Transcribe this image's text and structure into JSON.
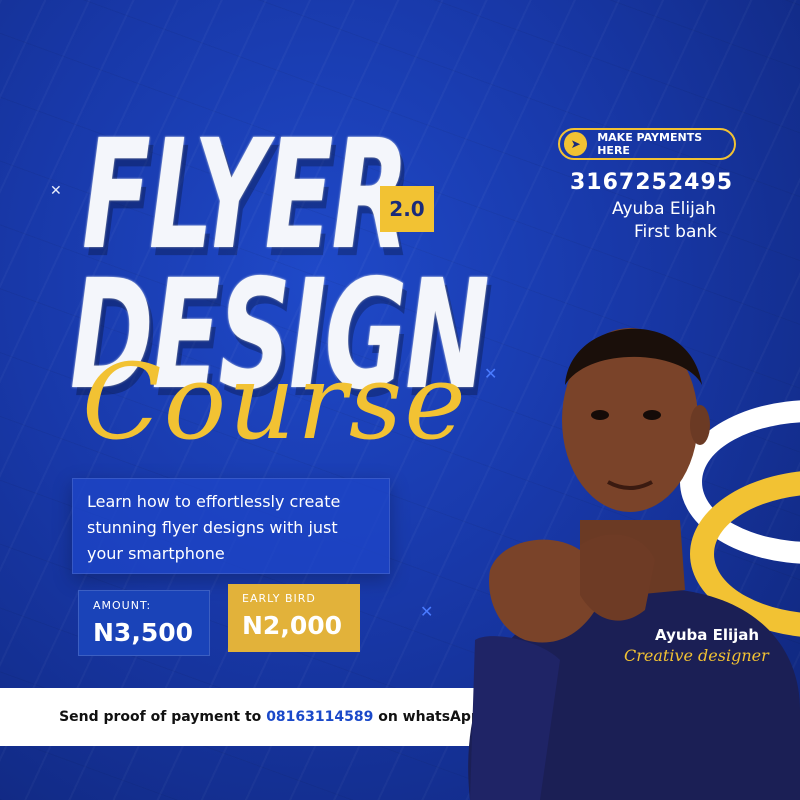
{
  "title": {
    "line1": "FLYER",
    "line2": "DESIGN",
    "script": "Course",
    "version": "2.0"
  },
  "description": "Learn how to effortlessly create stunning flyer designs with just your smartphone",
  "prices": {
    "amount": {
      "label": "AMOUNT:",
      "value": "N3,500"
    },
    "early_bird": {
      "label": "EARLY BIRD",
      "value": "N2,000"
    }
  },
  "footer": {
    "prefix": "Send proof of payment to",
    "phone": "08163114589",
    "suffix": "on whatsApp"
  },
  "payment": {
    "button_label": "MAKE PAYMENTS HERE",
    "icon": "cursor-arrow-icon",
    "account_number": "3167252495",
    "account_name": "Ayuba Elijah",
    "bank": "First bank"
  },
  "designer": {
    "name": "Ayuba Elijah",
    "title": "Creative designer"
  },
  "colors": {
    "background": "#1838a8",
    "accent_yellow": "#f2c233",
    "white": "#ffffff"
  }
}
